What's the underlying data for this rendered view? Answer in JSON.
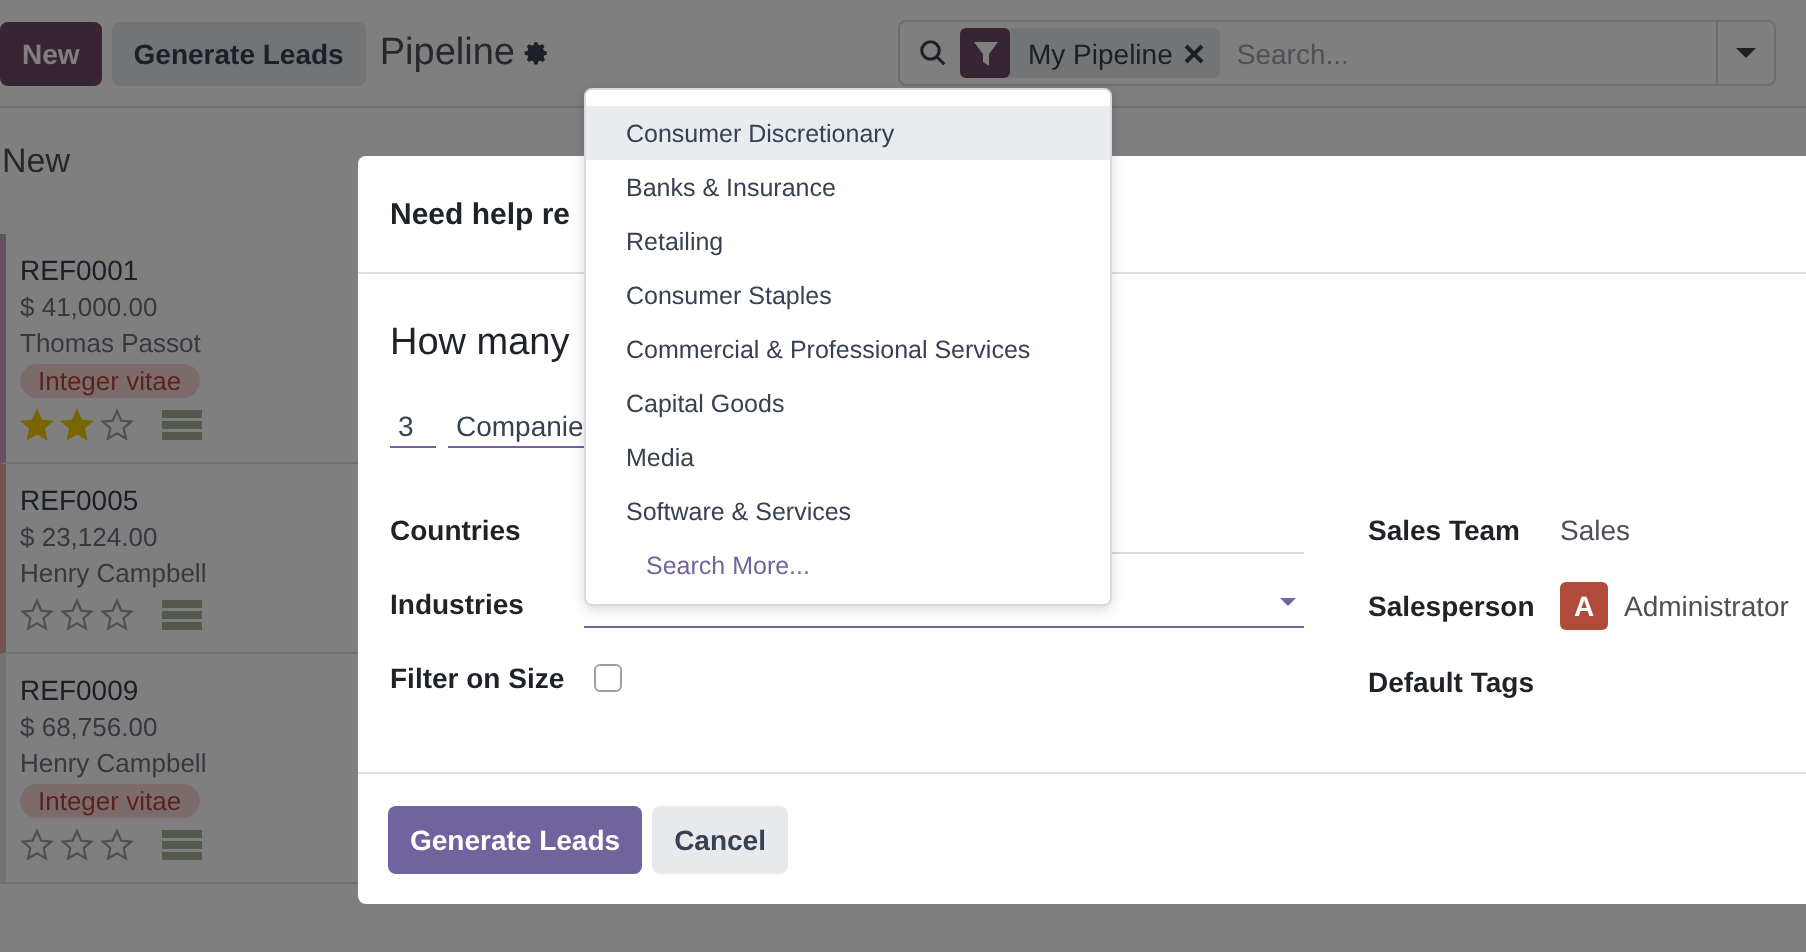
{
  "toolbar": {
    "buttons": [
      {
        "label": "New",
        "kind": "primary"
      },
      {
        "label": "Generate Leads",
        "kind": "secondary"
      }
    ],
    "title": "Pipeline"
  },
  "search": {
    "facet": "My Pipeline",
    "placeholder": "Search..."
  },
  "kanban": {
    "column": "New",
    "cards": [
      {
        "ref": "REF0001",
        "amount": "$ 41,000.00",
        "customer": "Thomas Passot",
        "tag": "Integer vitae",
        "stars": 2
      },
      {
        "ref": "REF0005",
        "amount": "$ 23,124.00",
        "customer": "Henry Campbell",
        "stars": 0
      },
      {
        "ref": "REF0009",
        "amount": "$ 68,756.00",
        "customer": "Henry Campbell",
        "tag": "Integer vitae",
        "stars": 0
      }
    ]
  },
  "dialog": {
    "title": "Need help re",
    "heading": "How many",
    "count": "3",
    "count_unit": "Companie",
    "fields_left": [
      {
        "label": "Countries",
        "kind": "text"
      },
      {
        "label": "Industries",
        "kind": "select"
      },
      {
        "label": "Filter on Size",
        "kind": "checkbox",
        "checked": false
      }
    ],
    "fields_right": [
      {
        "label": "Sales Team",
        "value": "Sales"
      },
      {
        "label": "Salesperson",
        "value": "Administrator",
        "avatar": "A"
      },
      {
        "label": "Default Tags"
      }
    ],
    "buttons": [
      {
        "label": "Generate Leads",
        "kind": "primary"
      },
      {
        "label": "Cancel",
        "kind": "secondary"
      }
    ]
  },
  "dropdown": {
    "options": [
      {
        "label": "Consumer Discretionary",
        "selected": true
      },
      {
        "label": "Banks & Insurance",
        "selected": false
      },
      {
        "label": "Retailing",
        "selected": false
      },
      {
        "label": "Consumer Staples",
        "selected": false
      },
      {
        "label": "Commercial & Professional Services",
        "selected": false
      },
      {
        "label": "Capital Goods",
        "selected": false
      },
      {
        "label": "Media",
        "selected": false
      },
      {
        "label": "Software & Services",
        "selected": false
      }
    ],
    "search_more": "Search More..."
  }
}
